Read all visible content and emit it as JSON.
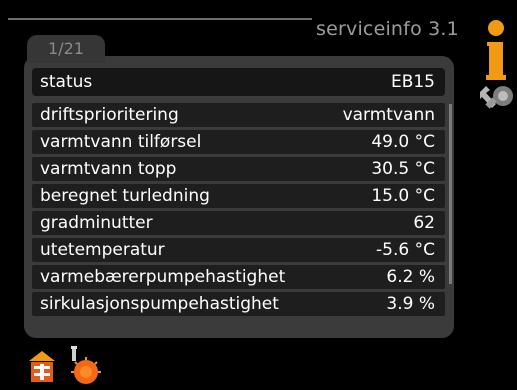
{
  "header": {
    "title": "serviceinfo 3.1",
    "page_indicator": "1/21"
  },
  "status": {
    "label": "status",
    "value": "EB15"
  },
  "rows": [
    {
      "label": "driftsprioritering",
      "value": "varmtvann"
    },
    {
      "label": "varmtvann tilførsel",
      "value": "49.0 °C"
    },
    {
      "label": "varmtvann topp",
      "value": "30.5 °C"
    },
    {
      "label": "beregnet turledning",
      "value": "15.0 °C"
    },
    {
      "label": "gradminutter",
      "value": "62"
    },
    {
      "label": "utetemperatur",
      "value": "-5.6 °C"
    },
    {
      "label": "varmebærerpumpehastighet",
      "value": "6.2 %"
    },
    {
      "label": "sirkulasjonspumpehastighet",
      "value": "3.9 %"
    }
  ],
  "icons": {
    "info": "info-icon",
    "tools": "tools-icon",
    "house": "house-heating-icon",
    "heat": "heat-source-icon"
  },
  "colors": {
    "accent": "#f39a15",
    "background": "#000000",
    "panel": "#3b3b3b"
  }
}
